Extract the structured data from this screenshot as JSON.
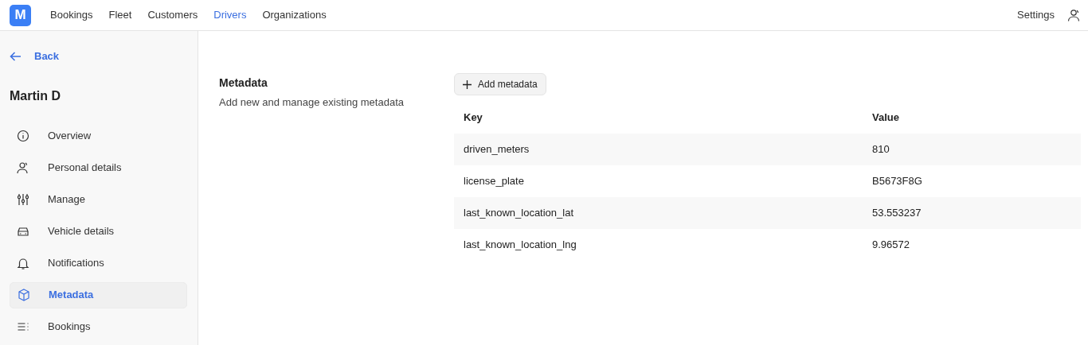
{
  "navbar": {
    "logo": "M",
    "links": [
      {
        "label": "Bookings",
        "selected": false
      },
      {
        "label": "Fleet",
        "selected": false
      },
      {
        "label": "Customers",
        "selected": false
      },
      {
        "label": "Drivers",
        "selected": true
      },
      {
        "label": "Organizations",
        "selected": false
      }
    ],
    "settings": "Settings"
  },
  "sidebar": {
    "back": "Back",
    "title": "Martin D",
    "items": [
      {
        "label": "Overview",
        "selected": false
      },
      {
        "label": "Personal details",
        "selected": false
      },
      {
        "label": "Manage",
        "selected": false
      },
      {
        "label": "Vehicle details",
        "selected": false
      },
      {
        "label": "Notifications",
        "selected": false
      },
      {
        "label": "Metadata",
        "selected": true
      },
      {
        "label": "Bookings",
        "selected": false
      }
    ]
  },
  "section": {
    "title": "Metadata",
    "description": "Add new and manage existing metadata",
    "add_button": "Add metadata"
  },
  "table": {
    "columns": [
      "Key",
      "Value"
    ],
    "rows": [
      [
        "driven_meters",
        "810"
      ],
      [
        "license_plate",
        "B5673F8G"
      ],
      [
        "last_known_location_lat",
        "53.553237"
      ],
      [
        "last_known_location_lng",
        "9.96572"
      ]
    ]
  }
}
